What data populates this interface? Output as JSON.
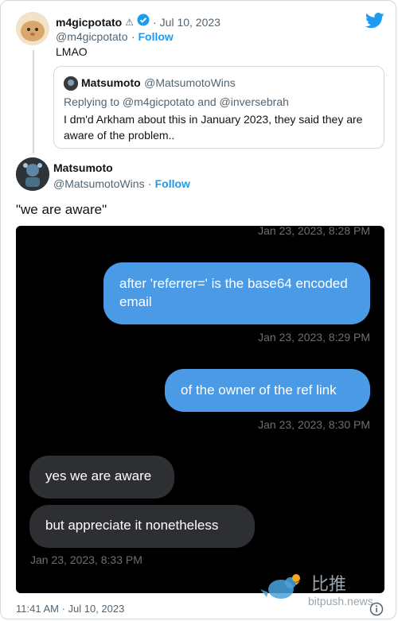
{
  "tweet": {
    "author": {
      "name": "m4gicpotato",
      "handle": "@m4gicpotato",
      "badge": "⚠",
      "verified": true
    },
    "date": "Jul 10, 2023",
    "follow_label": "Follow",
    "text": "LMAO"
  },
  "quoted": {
    "author": {
      "name": "Matsumoto",
      "handle": "@MatsumotoWins"
    },
    "replying_to": "Replying to @m4gicpotato and @inversebrah",
    "text": "I dm'd Arkham about this in January 2023, they said they are aware of the problem.."
  },
  "reply": {
    "author": {
      "name": "Matsumoto",
      "handle": "@MatsumotoWins"
    },
    "follow_label": "Follow",
    "text": "\"we are aware\""
  },
  "chat": {
    "ts_top": "Jan 23, 2023, 8:28 PM",
    "msg1": "after 'referrer=' is the base64 encoded email",
    "ts1": "Jan 23, 2023, 8:29 PM",
    "msg2": "of the owner of the ref link",
    "ts2": "Jan 23, 2023, 8:30 PM",
    "msg3": "yes we are aware",
    "msg4": "but appreciate it nonetheless",
    "ts3": "Jan 23, 2023, 8:33 PM"
  },
  "footer": {
    "timestamp": "11:41 AM · Jul 10, 2023"
  },
  "watermark": {
    "cn": "比推",
    "url": "bitpush.news"
  },
  "colors": {
    "link": "#1d9bf0",
    "bubble_blue": "#4a9ae6",
    "bubble_gray": "#2d2f32"
  },
  "icons": [
    "twitter-bird-icon",
    "verified-badge-icon",
    "warning-icon",
    "info-icon"
  ]
}
